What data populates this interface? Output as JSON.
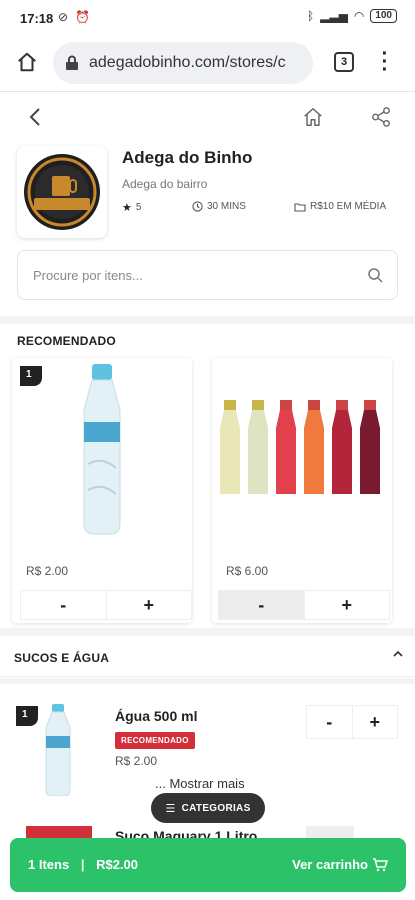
{
  "status_bar": {
    "time": "17:18",
    "battery": "100"
  },
  "browser": {
    "url": "adegadobinho.com/stores/c",
    "tab_count": "3"
  },
  "store": {
    "name": "Adega do Binho",
    "subtitle": "Adega do bairro",
    "rating": "5",
    "time": "30 MINS",
    "avg_price": "R$10 EM MÉDIA",
    "logo_text": [
      "ADEGA",
      "DO",
      "BINHO"
    ]
  },
  "search": {
    "placeholder": "Procure por itens..."
  },
  "recommended": {
    "title": "RECOMENDADO",
    "items": [
      {
        "badge": "1",
        "price": "R$ 2.00",
        "minus": "-",
        "plus": "+"
      },
      {
        "price": "R$ 6.00",
        "minus": "-",
        "plus": "+"
      }
    ]
  },
  "section": {
    "title": "SUCOS E ÁGUA",
    "product": {
      "badge": "1",
      "name": "Água 500 ml",
      "tag": "RECOMENDADO",
      "price": "R$ 2.00",
      "minus": "-",
      "plus": "+"
    },
    "show_more": "... Mostrar mais",
    "next_product_name": "Suco Maguary 1 Litro"
  },
  "categories_button": "CATEGORIAS",
  "cart": {
    "items": "1 Itens",
    "separator": "|",
    "total": "R$2.00",
    "action": "Ver carrinho"
  },
  "colors": {
    "accent_green": "#2cc26a",
    "tag_red": "#d32f3a",
    "dark_pill": "#333333"
  }
}
